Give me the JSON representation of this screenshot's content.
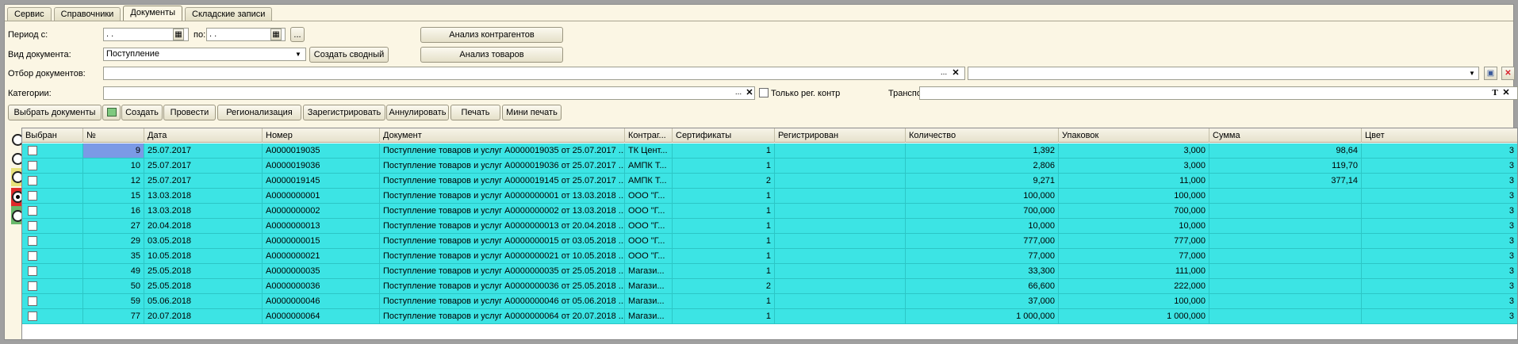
{
  "tabs": [
    "Сервис",
    "Справочники",
    "Документы",
    "Складские записи"
  ],
  "active_tab": 2,
  "filters": {
    "period_from_label": "Период с:",
    "period_from_value": " .  .",
    "period_to_label": "по:",
    "period_to_value": " .  .",
    "ellipsis": "...",
    "doc_type_label": "Вид документа:",
    "doc_type_value": "Поступление",
    "create_summary": "Создать сводный",
    "analysis_contractors": "Анализ контрагентов",
    "analysis_goods": "Анализ товаров",
    "selection_label": "Отбор документов:",
    "selection_value": "",
    "categories_label": "Категории:",
    "categories_value": "",
    "only_reg_label": "Только рег. контр",
    "transport_label": "Транспорт:",
    "transport_value": ""
  },
  "toolbar": {
    "select_docs": "Выбрать документы",
    "create": "Создать",
    "post": "Провести",
    "regionalization": "Регионализация",
    "register": "Зарегистрировать",
    "annul": "Аннулировать",
    "print": "Печать",
    "mini_print": "Мини печать"
  },
  "grid": {
    "columns": [
      "Выбран",
      "№",
      "Дата",
      "Номер",
      "Документ",
      "Контраг...",
      "Сертификаты",
      "Регистрирован",
      "Количество",
      "Упаковок",
      "Сумма",
      "Цвет"
    ],
    "rows": [
      {
        "num": "9",
        "date": "25.07.2017",
        "number": "A0000019035",
        "doc": "Поступление товаров и услуг A0000019035 от 25.07.2017 ...",
        "contr": "ТК Цент...",
        "cert": "1",
        "reg": "",
        "qty": "1,392",
        "packs": "3,000",
        "sum": "98,64",
        "color": "3"
      },
      {
        "num": "10",
        "date": "25.07.2017",
        "number": "A0000019036",
        "doc": "Поступление товаров и услуг A0000019036 от 25.07.2017 ...",
        "contr": "АМПК Т...",
        "cert": "1",
        "reg": "",
        "qty": "2,806",
        "packs": "3,000",
        "sum": "119,70",
        "color": "3"
      },
      {
        "num": "12",
        "date": "25.07.2017",
        "number": "A0000019145",
        "doc": "Поступление товаров и услуг A0000019145 от 25.07.2017 ...",
        "contr": "АМПК Т...",
        "cert": "2",
        "reg": "",
        "qty": "9,271",
        "packs": "11,000",
        "sum": "377,14",
        "color": "3"
      },
      {
        "num": "15",
        "date": "13.03.2018",
        "number": "A0000000001",
        "doc": "Поступление товаров и услуг A0000000001 от 13.03.2018 ...",
        "contr": "ООО \"Г...",
        "cert": "1",
        "reg": "",
        "qty": "100,000",
        "packs": "100,000",
        "sum": "",
        "color": "3"
      },
      {
        "num": "16",
        "date": "13.03.2018",
        "number": "A0000000002",
        "doc": "Поступление товаров и услуг A0000000002 от 13.03.2018 ...",
        "contr": "ООО \"Г...",
        "cert": "1",
        "reg": "",
        "qty": "700,000",
        "packs": "700,000",
        "sum": "",
        "color": "3"
      },
      {
        "num": "27",
        "date": "20.04.2018",
        "number": "A0000000013",
        "doc": "Поступление товаров и услуг A0000000013 от 20.04.2018 ...",
        "contr": "ООО \"Г...",
        "cert": "1",
        "reg": "",
        "qty": "10,000",
        "packs": "10,000",
        "sum": "",
        "color": "3"
      },
      {
        "num": "29",
        "date": "03.05.2018",
        "number": "A0000000015",
        "doc": "Поступление товаров и услуг A0000000015 от 03.05.2018 ...",
        "contr": "ООО \"Г...",
        "cert": "1",
        "reg": "",
        "qty": "777,000",
        "packs": "777,000",
        "sum": "",
        "color": "3"
      },
      {
        "num": "35",
        "date": "10.05.2018",
        "number": "A0000000021",
        "doc": "Поступление товаров и услуг A0000000021 от 10.05.2018 ...",
        "contr": "ООО \"Г...",
        "cert": "1",
        "reg": "",
        "qty": "77,000",
        "packs": "77,000",
        "sum": "",
        "color": "3"
      },
      {
        "num": "49",
        "date": "25.05.2018",
        "number": "A0000000035",
        "doc": "Поступление товаров и услуг A0000000035 от 25.05.2018 ...",
        "contr": "Магази...",
        "cert": "1",
        "reg": "",
        "qty": "33,300",
        "packs": "111,000",
        "sum": "",
        "color": "3"
      },
      {
        "num": "50",
        "date": "25.05.2018",
        "number": "A0000000036",
        "doc": "Поступление товаров и услуг A0000000036 от 25.05.2018 ...",
        "contr": "Магази...",
        "cert": "2",
        "reg": "",
        "qty": "66,600",
        "packs": "222,000",
        "sum": "",
        "color": "3"
      },
      {
        "num": "59",
        "date": "05.06.2018",
        "number": "A0000000046",
        "doc": "Поступление товаров и услуг A0000000046 от 05.06.2018 ...",
        "contr": "Магази...",
        "cert": "1",
        "reg": "",
        "qty": "37,000",
        "packs": "100,000",
        "sum": "",
        "color": "3"
      },
      {
        "num": "77",
        "date": "20.07.2018",
        "number": "A0000000064",
        "doc": "Поступление товаров и услуг A0000000064 от 20.07.2018 ...",
        "contr": "Магази...",
        "cert": "1",
        "reg": "",
        "qty": "1 000,000",
        "packs": "1 000,000",
        "sum": "",
        "color": "3"
      }
    ]
  },
  "radios": {
    "selected_index": 3,
    "count": 5
  },
  "colors": {
    "row_bg": "#3ce4e4",
    "selected_cell": "#7b9ae6",
    "arrow": "#e0202a",
    "background": "#fbf6e4"
  }
}
